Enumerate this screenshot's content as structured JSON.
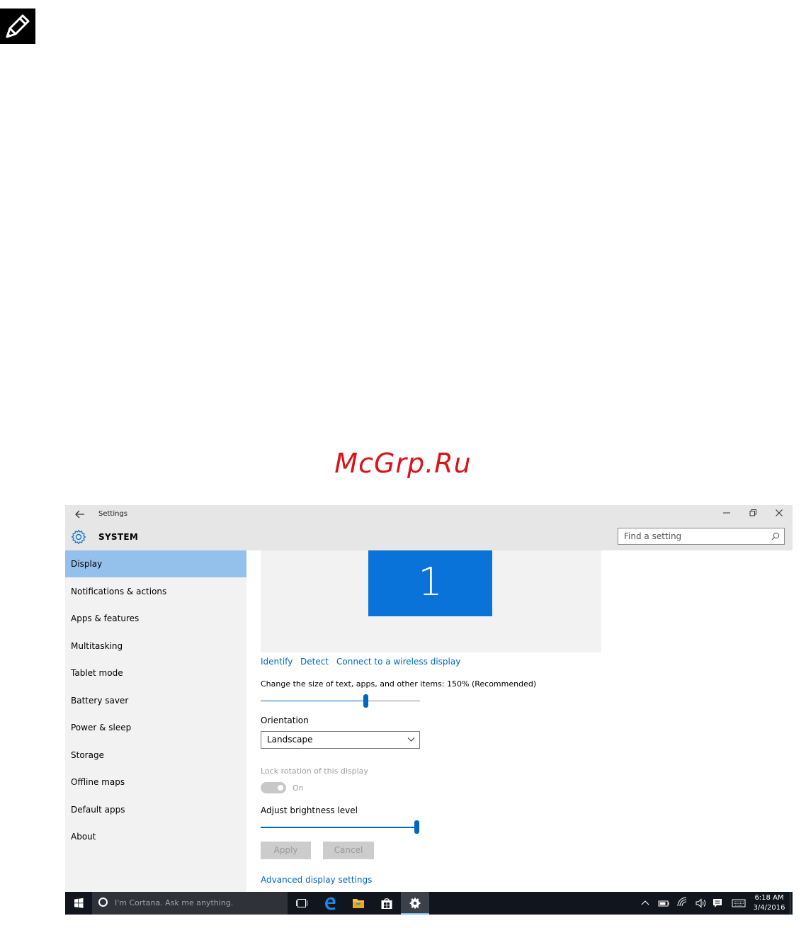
{
  "watermark": "McGrp.Ru",
  "window": {
    "title": "Settings",
    "section": "SYSTEM",
    "search_placeholder": "Find a setting"
  },
  "sidebar": {
    "items": [
      {
        "label": "Display",
        "active": true
      },
      {
        "label": "Notifications & actions"
      },
      {
        "label": "Apps & features"
      },
      {
        "label": "Multitasking"
      },
      {
        "label": "Tablet mode"
      },
      {
        "label": "Battery saver"
      },
      {
        "label": "Power & sleep"
      },
      {
        "label": "Storage"
      },
      {
        "label": "Offline maps"
      },
      {
        "label": "Default apps"
      },
      {
        "label": "About"
      }
    ]
  },
  "content": {
    "monitor_number": "1",
    "links": {
      "identify": "Identify",
      "detect": "Detect",
      "wireless": "Connect to a wireless display",
      "advanced": "Advanced display settings"
    },
    "scale_label": "Change the size of text, apps, and other items: 150% (Recommended)",
    "scale_slider_level": 0.66,
    "orientation_label": "Orientation",
    "orientation_value": "Landscape",
    "lock_rotation_label": "Lock rotation of this display",
    "lock_rotation_state": "On",
    "brightness_label": "Adjust brightness level",
    "brightness_level": 1.0,
    "apply_label": "Apply",
    "cancel_label": "Cancel"
  },
  "taskbar": {
    "cortana_placeholder": "I'm Cortana. Ask me anything.",
    "time": "6:18 AM",
    "date": "3/4/2016"
  },
  "colors": {
    "accent": "#0067c0",
    "sidebar_active": "#93c1ec",
    "monitor_tile": "#0a73d9",
    "taskbar": "#10151e",
    "watermark": "#d9141a"
  }
}
